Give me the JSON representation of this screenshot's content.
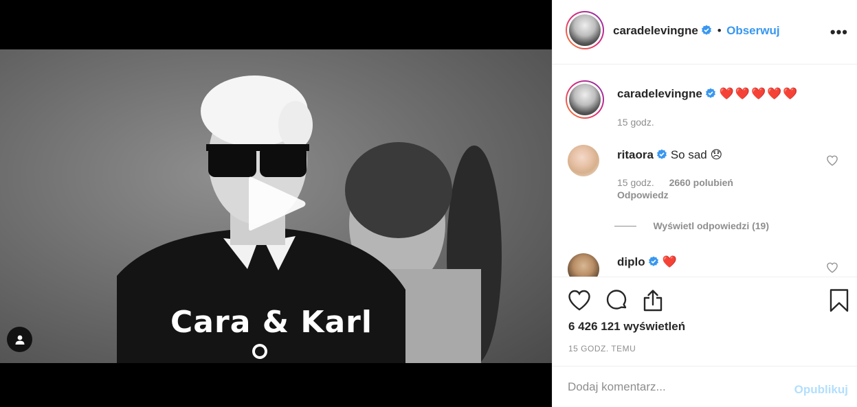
{
  "media": {
    "overlay_text": "Cara & Karl",
    "play_icon": "play-icon",
    "user_tag_icon": "user-icon"
  },
  "header": {
    "username": "caradelevingne",
    "verified_icon": "verified-badge-icon",
    "separator": "•",
    "follow_label": "Obserwuj",
    "more_label": "•••"
  },
  "caption": {
    "username": "caradelevingne",
    "text": "❤️❤️❤️❤️❤️",
    "time": "15 godz."
  },
  "comments": [
    {
      "username": "ritaora",
      "text": "So sad 😞",
      "time": "15 godz.",
      "likes": "2660 polubień",
      "reply_label": "Odpowiedz",
      "view_replies_label": "Wyświetl odpowiedzi (19)"
    },
    {
      "username": "diplo",
      "text": "❤️"
    }
  ],
  "actions": {
    "views": "6 426 121 wyświetleń",
    "time_ago": "15 GODZ. TEMU"
  },
  "add_comment": {
    "placeholder": "Dodaj komentarz...",
    "publish_label": "Opublikuj"
  },
  "colors": {
    "accent": "#3897f0",
    "publish_disabled": "#b2dffc",
    "muted": "#8e8e8e",
    "heart_red": "#e0245e"
  }
}
